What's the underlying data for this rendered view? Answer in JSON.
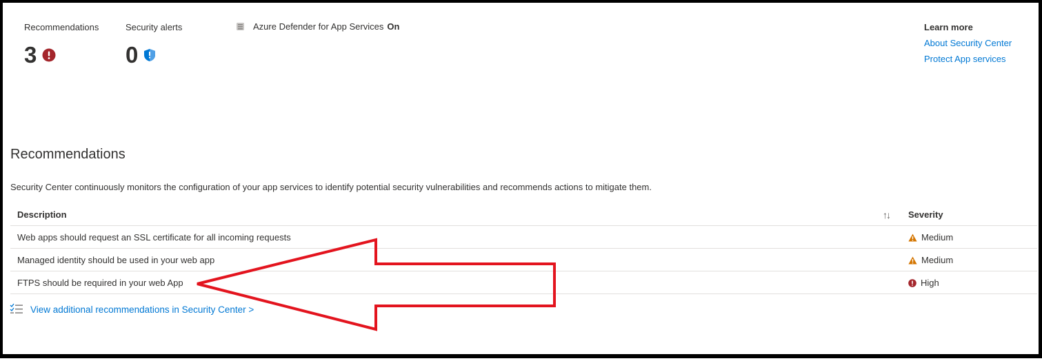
{
  "metrics": {
    "recommendations": {
      "label": "Recommendations",
      "value": "3",
      "icon": "error-circle-icon"
    },
    "security_alerts": {
      "label": "Security alerts",
      "value": "0",
      "icon": "shield-icon"
    }
  },
  "defender": {
    "label": "Azure Defender for App Services",
    "status": "On",
    "icon": "database-icon"
  },
  "learn_more": {
    "heading": "Learn more",
    "links": [
      "About Security Center",
      "Protect App services"
    ]
  },
  "recommendations_section": {
    "title": "Recommendations",
    "description": "Security Center continuously monitors the configuration of your app services to identify potential security vulnerabilities and recommends actions to mitigate them."
  },
  "table": {
    "headers": {
      "description": "Description",
      "severity": "Severity"
    },
    "rows": [
      {
        "description": "Web apps should request an SSL certificate for all incoming requests",
        "severity": "Medium",
        "icon": "warning-icon"
      },
      {
        "description": "Managed identity should be used in your web app",
        "severity": "Medium",
        "icon": "warning-icon"
      },
      {
        "description": "FTPS should be required in your web App",
        "severity": "High",
        "icon": "error-circle-icon"
      }
    ]
  },
  "view_more": {
    "label": "View additional recommendations in Security Center >",
    "icon": "checklist-icon"
  },
  "colors": {
    "accent": "#0078d4",
    "error": "#a4262c",
    "warning": "#d47500",
    "annotation": "#e3141e"
  }
}
